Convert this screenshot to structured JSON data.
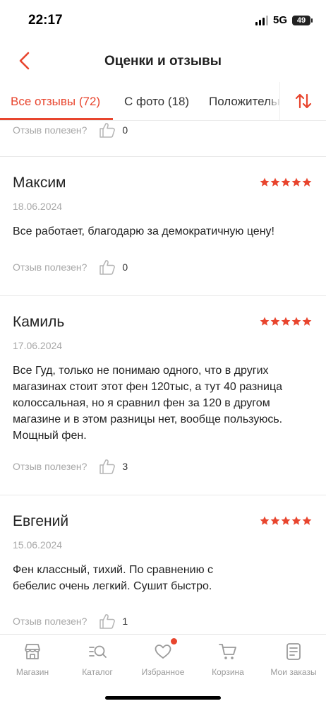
{
  "status_bar": {
    "time": "22:17",
    "network": "5G",
    "battery": "49"
  },
  "header": {
    "title": "Оценки и отзывы",
    "back_icon": "chevron-left-icon"
  },
  "tabs": [
    {
      "label": "Все отзывы (72)",
      "active": true
    },
    {
      "label": "С фото (18)",
      "active": false
    },
    {
      "label": "Положительные",
      "active": false
    }
  ],
  "sort_icon": "sort-arrows-icon",
  "accent_color": "#e8452e",
  "helpful_label": "Отзыв полезен?",
  "top_partial": {
    "helpful_count": "0"
  },
  "reviews": [
    {
      "name": "Максим",
      "date": "18.06.2024",
      "rating": 5,
      "text": "Все работает, благодарю за демократичную цену!",
      "helpful_count": "0"
    },
    {
      "name": "Камиль",
      "date": "17.06.2024",
      "rating": 5,
      "text": "Все Гуд, только не понимаю одного, что в других магазинах стоит этот фен 120тыс, а тут 40 разница колоссальная, но я сравнил фен за 120 в другом магазине и в этом разницы нет, вообще пользуюсь. Мощный фен.",
      "helpful_count": "3"
    },
    {
      "name": "Евгений",
      "date": "15.06.2024",
      "rating": 5,
      "text": "Фен классный, тихий. По сравнению с бебелис очень легкий. Сушит быстро.",
      "helpful_count": "1"
    }
  ],
  "bottom_nav": [
    {
      "label": "Магазин",
      "icon": "store-icon"
    },
    {
      "label": "Каталог",
      "icon": "catalog-search-icon"
    },
    {
      "label": "Избранное",
      "icon": "heart-icon",
      "badge": true
    },
    {
      "label": "Корзина",
      "icon": "cart-icon"
    },
    {
      "label": "Мои заказы",
      "icon": "orders-icon"
    }
  ]
}
